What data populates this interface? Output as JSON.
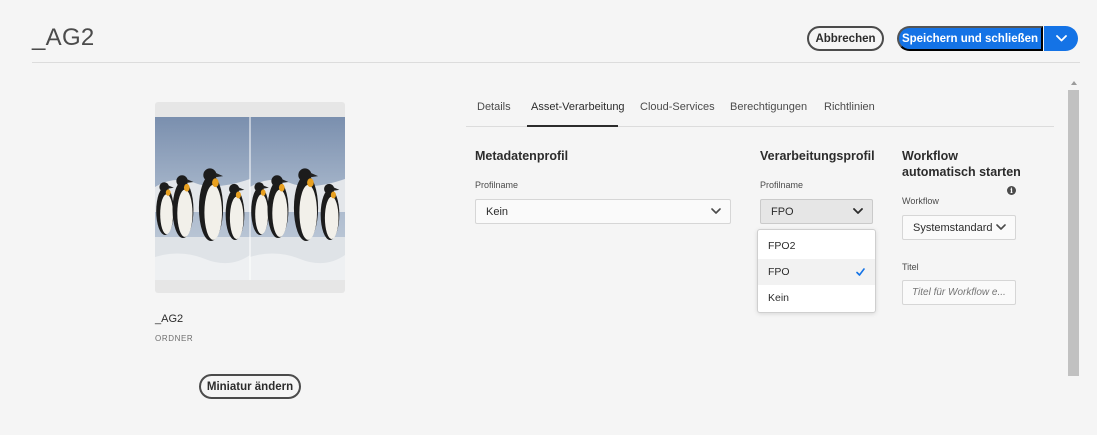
{
  "header": {
    "title": "_AG2",
    "cancel_label": "Abbrechen",
    "save_label": "Speichern und schließen"
  },
  "asset": {
    "name": "_AG2",
    "type": "ORDNER",
    "change_thumbnail_label": "Miniatur ändern"
  },
  "tabs": [
    {
      "label": "Details"
    },
    {
      "label": "Asset-Verarbeitung",
      "active": true
    },
    {
      "label": "Cloud-Services"
    },
    {
      "label": "Berechtigungen"
    },
    {
      "label": "Richtlinien"
    }
  ],
  "metadata_profile": {
    "title": "Metadatenprofil",
    "field_label": "Profilname",
    "value": "Kein"
  },
  "processing_profile": {
    "title": "Verarbeitungsprofil",
    "field_label": "Profilname",
    "value": "FPO",
    "options": [
      {
        "label": "FPO2"
      },
      {
        "label": "FPO",
        "selected": true
      },
      {
        "label": "Kein"
      }
    ]
  },
  "workflow": {
    "title_line1": "Workflow",
    "title_line2": "automatisch starten",
    "workflow_label": "Workflow",
    "workflow_value": "Systemstandard",
    "title_label": "Titel",
    "title_placeholder": "Titel für Workflow e..."
  },
  "colors": {
    "accent": "#1473e6",
    "background": "#f5f5f5",
    "text": "#2c2c2c"
  },
  "icons": [
    "chevron-down-icon",
    "checkmark-icon",
    "info-icon"
  ]
}
